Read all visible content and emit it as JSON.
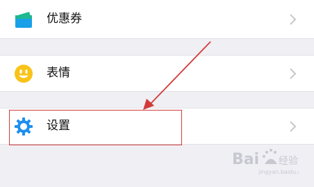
{
  "menu": {
    "items": [
      {
        "label": "优惠券",
        "icon": "coupon-icon"
      },
      {
        "label": "表情",
        "icon": "emoji-icon"
      },
      {
        "label": "设置",
        "icon": "settings-gear-icon"
      }
    ]
  },
  "annotation": {
    "highlight_color": "#d23a3a"
  },
  "watermark": {
    "text": "Bai 经验",
    "subtext": "jingyan.baidu.com"
  },
  "colors": {
    "background": "#efeff4",
    "row_background": "#ffffff",
    "coupon_green": "#1fb890",
    "coupon_blue": "#1aa0e8",
    "emoji_yellow": "#f9c318",
    "gear_blue": "#1e8ff0",
    "chevron_gray": "#c7c7cc"
  }
}
